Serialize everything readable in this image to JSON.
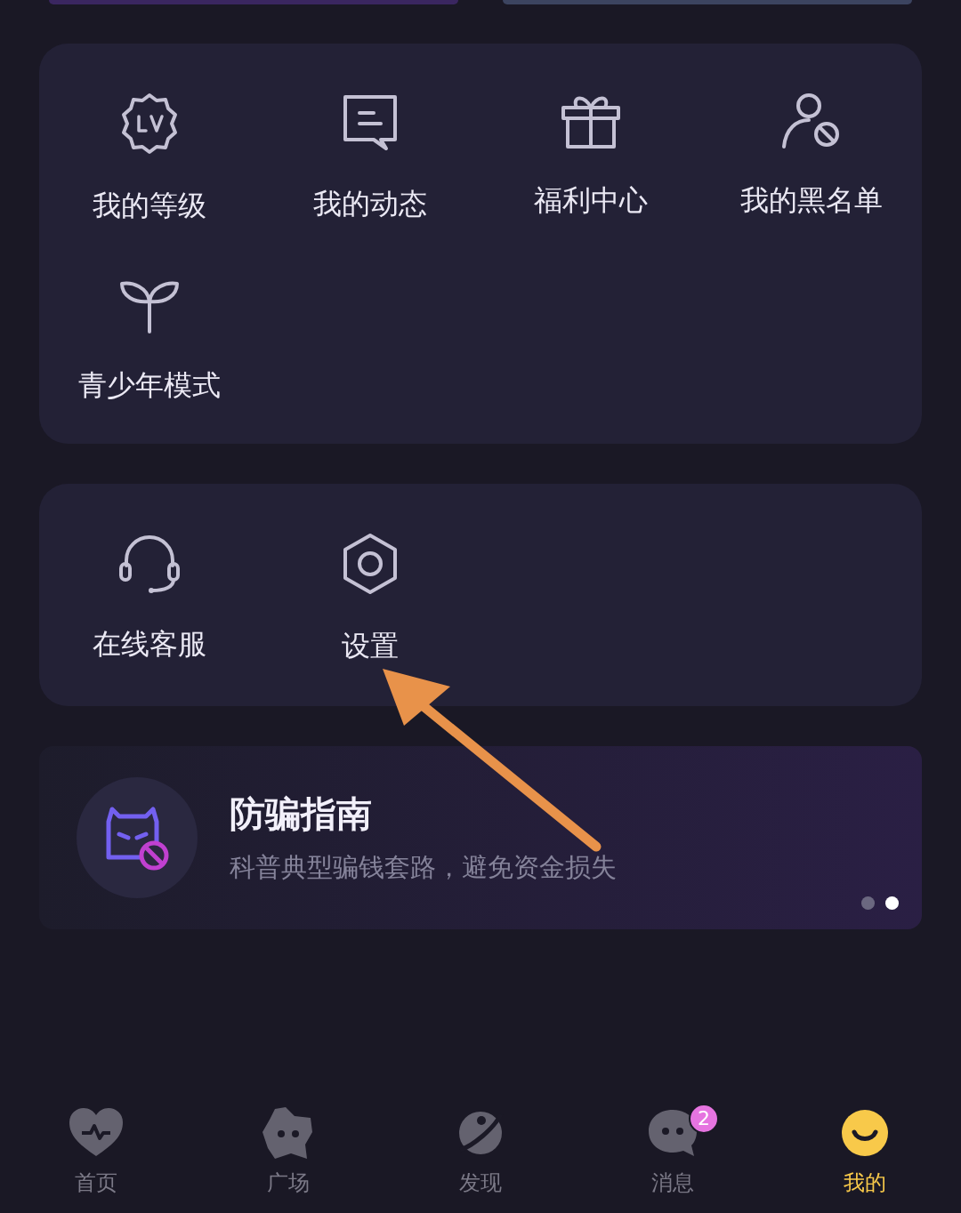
{
  "menu_groups": [
    {
      "items": [
        {
          "label": "我的等级"
        },
        {
          "label": "我的动态"
        },
        {
          "label": "福利中心"
        },
        {
          "label": "我的黑名单"
        },
        {
          "label": "青少年模式"
        }
      ]
    },
    {
      "items": [
        {
          "label": "在线客服"
        },
        {
          "label": "设置"
        }
      ]
    }
  ],
  "banner": {
    "title": "防骗指南",
    "subtitle": "科普典型骗钱套路，避免资金损失",
    "dots": [
      {
        "selected": false
      },
      {
        "selected": true
      }
    ]
  },
  "bottom_nav": [
    {
      "label": "首页",
      "selected": false
    },
    {
      "label": "广场",
      "selected": false
    },
    {
      "label": "发现",
      "selected": false
    },
    {
      "label": "消息",
      "selected": false,
      "badge": "2"
    },
    {
      "label": "我的",
      "selected": true
    }
  ]
}
